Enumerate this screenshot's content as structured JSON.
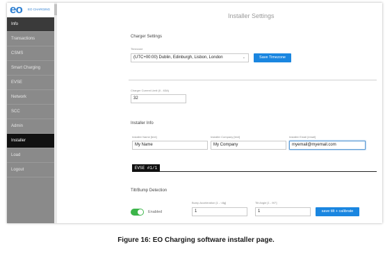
{
  "brand": {
    "mark": "eo",
    "name": "EO CHARGING"
  },
  "sidebar": {
    "items": [
      {
        "label": "Info"
      },
      {
        "label": "Transactions"
      },
      {
        "label": "CSMS"
      },
      {
        "label": "Smart Charging"
      },
      {
        "label": "EVSE"
      },
      {
        "label": "Network"
      },
      {
        "label": "SCC"
      },
      {
        "label": "Admin"
      },
      {
        "label": "Installer"
      },
      {
        "label": "Load"
      },
      {
        "label": "Logout"
      }
    ],
    "active": "Installer"
  },
  "page": {
    "title": "Installer Settings"
  },
  "charger_settings": {
    "title": "Charger Settings",
    "timezone_label": "Timezone",
    "timezone_value": "(UTC+00:00) Dublin, Edinburgh, Lisbon, London",
    "save_timezone": "Save Timezone",
    "current_limit_label": "Charger Current Limit (0 - 63A)",
    "current_limit_value": "32"
  },
  "installer_info": {
    "title": "Installer Info",
    "name_label": "Installer Name [text]",
    "name_value": "My Name",
    "company_label": "Installer Company [text]",
    "company_value": "My Company",
    "email_label": "Installer Email [email]",
    "email_value": "myemail@myemail.com"
  },
  "evse_tab": "EVSE #1/1",
  "tilt": {
    "title": "Tilt/Bump Detection",
    "enabled_label": "Enabled",
    "enabled": true,
    "bump_label": "Bump Acceleration [1 - <8g]",
    "bump_value": "1",
    "tilt_label": "Tilt Angle [1 - 90°]",
    "tilt_value": "1",
    "save_button": "save tilt + calibrate"
  },
  "caption": "Figure 16: EO Charging software installer page.",
  "colors": {
    "accent": "#1a86e0",
    "sidebar": "#8a8a8a",
    "toggle_on": "#3cb54a"
  }
}
